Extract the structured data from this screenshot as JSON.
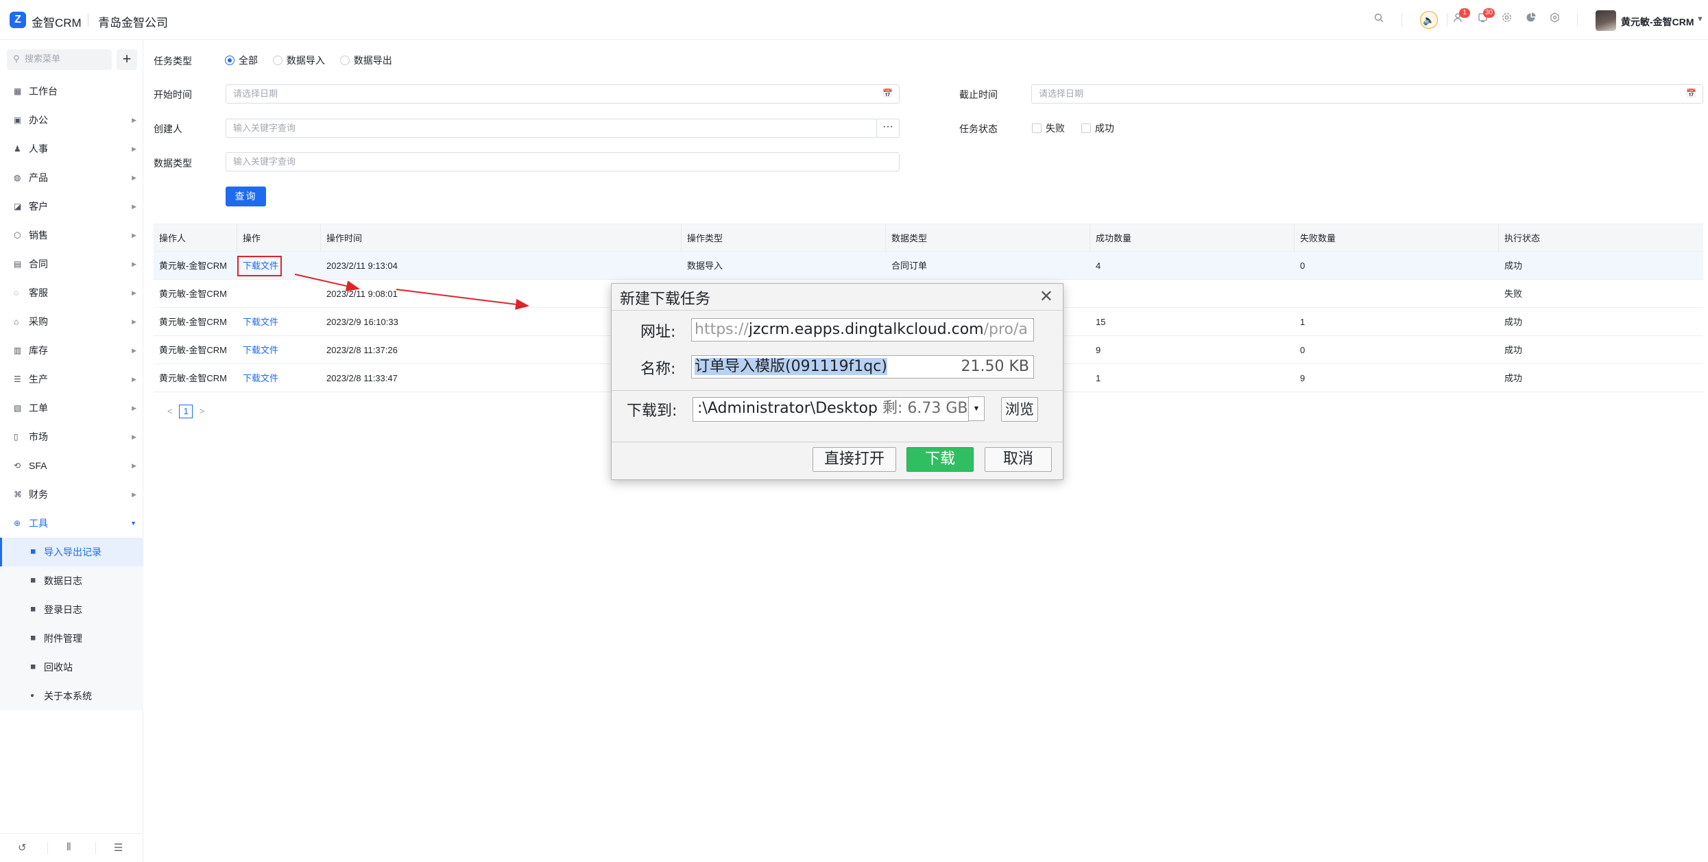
{
  "header": {
    "logo_glyph": "Z",
    "brand": "金智CRM",
    "company": "青岛金智公司",
    "badges": {
      "contacts": "1",
      "notifications": "30"
    },
    "user_name": "黄元敏-金智CRM",
    "caret": "▼"
  },
  "sidebar": {
    "search_placeholder": "搜索菜单",
    "add_label": "+",
    "items": [
      {
        "label": "工作台",
        "icon": "dashboard-icon",
        "has_children": false
      },
      {
        "label": "办公",
        "icon": "office-icon",
        "has_children": true
      },
      {
        "label": "人事",
        "icon": "people-icon",
        "has_children": true
      },
      {
        "label": "产品",
        "icon": "product-icon",
        "has_children": true
      },
      {
        "label": "客户",
        "icon": "customer-icon",
        "has_children": true
      },
      {
        "label": "销售",
        "icon": "sales-icon",
        "has_children": true
      },
      {
        "label": "合同",
        "icon": "contract-icon",
        "has_children": true
      },
      {
        "label": "客服",
        "icon": "service-icon",
        "has_children": true
      },
      {
        "label": "采购",
        "icon": "purchase-icon",
        "has_children": true
      },
      {
        "label": "库存",
        "icon": "inventory-icon",
        "has_children": true
      },
      {
        "label": "生产",
        "icon": "production-icon",
        "has_children": true
      },
      {
        "label": "工单",
        "icon": "ticket-icon",
        "has_children": true
      },
      {
        "label": "市场",
        "icon": "market-icon",
        "has_children": true
      },
      {
        "label": "SFA",
        "icon": "sfa-icon",
        "has_children": true
      },
      {
        "label": "财务",
        "icon": "finance-icon",
        "has_children": true
      },
      {
        "label": "工具",
        "icon": "tools-icon",
        "has_children": true,
        "open": true
      }
    ],
    "sub_items": [
      {
        "label": "导入导出记录",
        "active": true
      },
      {
        "label": "数据日志",
        "active": false
      },
      {
        "label": "登录日志",
        "active": false
      },
      {
        "label": "附件管理",
        "active": false
      },
      {
        "label": "回收站",
        "active": false
      },
      {
        "label": "关于本系统",
        "active": false
      }
    ]
  },
  "filters": {
    "task_type_label": "任务类型",
    "task_type_options": [
      "全部",
      "数据导入",
      "数据导出"
    ],
    "task_type_selected": "全部",
    "start_time_label": "开始时间",
    "start_time_placeholder": "请选择日期",
    "end_time_label": "截止时间",
    "end_time_placeholder": "请选择日期",
    "creator_label": "创建人",
    "creator_placeholder": "输入关键字查询",
    "more_label": "···",
    "task_status_label": "任务状态",
    "task_status_options": [
      "失败",
      "成功"
    ],
    "data_type_label": "数据类型",
    "data_type_placeholder": "输入关键字查询",
    "query_button": "查询"
  },
  "table": {
    "columns": [
      "操作人",
      "操作",
      "操作时间",
      "操作类型",
      "数据类型",
      "成功数量",
      "失败数量",
      "执行状态"
    ],
    "rows": [
      [
        "黄元敏-金智CRM",
        "下载文件",
        "2023/2/11 9:13:04",
        "数据导入",
        "合同订单",
        "4",
        "0",
        "成功"
      ],
      [
        "黄元敏-金智CRM",
        "",
        "2023/2/11 9:08:01",
        "",
        "",
        "",
        "",
        "失败"
      ],
      [
        "黄元敏-金智CRM",
        "下载文件",
        "2023/2/9 16:10:33",
        "",
        "",
        "15",
        "1",
        "成功"
      ],
      [
        "黄元敏-金智CRM",
        "下载文件",
        "2023/2/8 11:37:26",
        "",
        "",
        "9",
        "0",
        "成功"
      ],
      [
        "黄元敏-金智CRM",
        "下载文件",
        "2023/2/8 11:33:47",
        "",
        "",
        "1",
        "9",
        "成功"
      ]
    ]
  },
  "pagination": {
    "prev": "<",
    "current": "1",
    "next": ">"
  },
  "dialog": {
    "title": "新建下载任务",
    "close": "✕",
    "url_label": "网址:",
    "url_prefix": "https://",
    "url_host": "jzcrm.eapps.dingtalkcloud.com",
    "url_path": "/pro/a",
    "name_label": "名称:",
    "name_value": "订单导入模版(091119f1qc)",
    "size": "21.50 KB",
    "save_to_label": "下载到:",
    "save_path": ":\\Administrator\\Desktop",
    "free_space": "剩: 6.73 GB",
    "dropdown": "▼",
    "browse_button": "浏览",
    "open_button": "直接打开",
    "download_button": "下载",
    "cancel_button": "取消"
  },
  "colors": {
    "accent": "#1f6bf0",
    "download_green": "#2fbf60",
    "annotation_red": "#e0222a"
  }
}
